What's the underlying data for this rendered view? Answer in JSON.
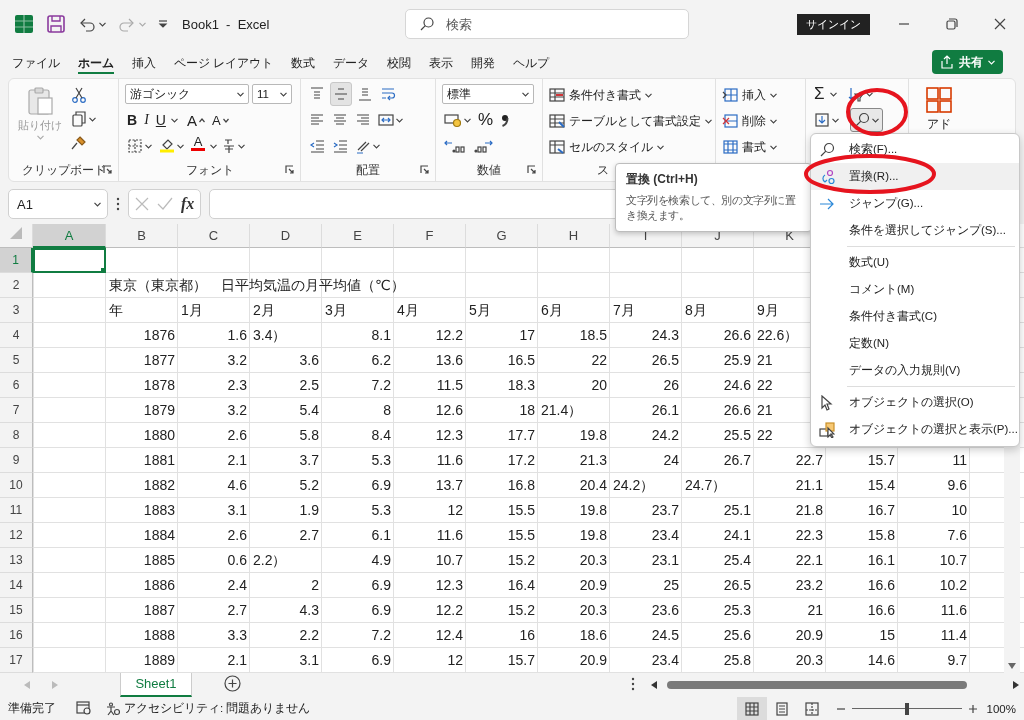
{
  "title_bar": {
    "title": "Book1  -  Excel",
    "search": {
      "placeholder": "検索"
    },
    "sign_in": "サインイン"
  },
  "menu_tabs": [
    {
      "label": "ファイル",
      "selected": false
    },
    {
      "label": "ホーム",
      "selected": true
    },
    {
      "label": "挿入",
      "selected": false
    },
    {
      "label": "ページ レイアウト",
      "selected": false
    },
    {
      "label": "数式",
      "selected": false
    },
    {
      "label": "データ",
      "selected": false
    },
    {
      "label": "校閲",
      "selected": false
    },
    {
      "label": "表示",
      "selected": false
    },
    {
      "label": "開発",
      "selected": false
    },
    {
      "label": "ヘルプ",
      "selected": false
    }
  ],
  "share_button": {
    "label": "共有"
  },
  "ribbon": {
    "clipboard": {
      "label": "クリップボード",
      "paste": {
        "label": "貼り付け",
        "disabled": true
      }
    },
    "font": {
      "label": "フォント",
      "font_name": "游ゴシック",
      "font_size": "11",
      "bold": "B",
      "italic": "I",
      "underline": "U",
      "grow": "A",
      "shrink": "A",
      "font_color_label": "A"
    },
    "alignment": {
      "label": "配置",
      "vertical": [
        {
          "kind": "top",
          "selected": false
        },
        {
          "kind": "middle",
          "selected": true
        },
        {
          "kind": "bottom",
          "selected": false
        }
      ]
    },
    "number": {
      "label": "数値",
      "format": "標準",
      "percent": "%"
    },
    "styles": {
      "label": "ス",
      "commands": [
        {
          "kind": "conditional",
          "label": "条件付き書式"
        },
        {
          "kind": "table",
          "label": "テーブルとして書式設定"
        },
        {
          "kind": "cellstyle",
          "label": "セルのスタイル"
        }
      ]
    },
    "cells": {
      "commands": [
        {
          "kind": "insert",
          "label": "挿入"
        },
        {
          "kind": "delete",
          "label": "削除"
        },
        {
          "kind": "format",
          "label": "書式"
        }
      ]
    },
    "editing": {
      "sum": "Σ",
      "find_pressed": true
    },
    "add_in": {
      "label": "アド"
    }
  },
  "formula_bar": {
    "name_box": "A1",
    "fx": "fx"
  },
  "sheet": {
    "columns": [
      {
        "label": "A",
        "selected": true
      },
      {
        "label": "B",
        "selected": false
      },
      {
        "label": "C",
        "selected": false
      },
      {
        "label": "D",
        "selected": false
      },
      {
        "label": "E",
        "selected": false
      },
      {
        "label": "F",
        "selected": false
      },
      {
        "label": "G",
        "selected": false
      },
      {
        "label": "H",
        "selected": false
      },
      {
        "label": "I",
        "selected": false
      },
      {
        "label": "J",
        "selected": false
      },
      {
        "label": "K",
        "selected": false
      }
    ],
    "rows": [
      {
        "label": "1",
        "selected": true,
        "cells": []
      },
      {
        "label": "2",
        "selected": false,
        "cells": [
          null,
          {
            "text": "東京（東京都）　日平均気温の月平均値（℃）",
            "kind": "text"
          }
        ]
      },
      {
        "label": "3",
        "selected": false,
        "cells": [
          null,
          {
            "text": "年",
            "kind": "text"
          },
          {
            "text": "1月",
            "kind": "text"
          },
          {
            "text": "2月",
            "kind": "text"
          },
          {
            "text": "3月",
            "kind": "text"
          },
          {
            "text": "4月",
            "kind": "text"
          },
          {
            "text": "5月",
            "kind": "text"
          },
          {
            "text": "6月",
            "kind": "text"
          },
          {
            "text": "7月",
            "kind": "text"
          },
          {
            "text": "8月",
            "kind": "text"
          },
          {
            "text": "9月",
            "kind": "text"
          }
        ]
      },
      {
        "label": "4",
        "selected": false,
        "cells": [
          null,
          "1876",
          "1.6",
          {
            "text": "3.4）",
            "kind": "text"
          },
          "8.1",
          "12.2",
          "17",
          "18.5",
          "24.3",
          "26.6",
          {
            "text": "22.6）",
            "kind": "text"
          }
        ]
      },
      {
        "label": "5",
        "selected": false,
        "cells": [
          null,
          "1877",
          "3.2",
          "3.6",
          "6.2",
          "13.6",
          "16.5",
          "22",
          "26.5",
          "25.9",
          {
            "text": "21",
            "kind": "text"
          }
        ]
      },
      {
        "label": "6",
        "selected": false,
        "cells": [
          null,
          "1878",
          "2.3",
          "2.5",
          "7.2",
          "11.5",
          "18.3",
          "20",
          "26",
          "24.6",
          {
            "text": "22",
            "kind": "text"
          }
        ]
      },
      {
        "label": "7",
        "selected": false,
        "cells": [
          null,
          "1879",
          "3.2",
          "5.4",
          "8",
          "12.6",
          "18",
          {
            "text": "21.4）",
            "kind": "text"
          },
          "26.1",
          "26.6",
          {
            "text": "21",
            "kind": "text"
          }
        ]
      },
      {
        "label": "8",
        "selected": false,
        "cells": [
          null,
          "1880",
          "2.6",
          "5.8",
          "8.4",
          "12.3",
          "17.7",
          "19.8",
          "24.2",
          "25.5",
          {
            "text": "22",
            "kind": "text"
          }
        ]
      },
      {
        "label": "9",
        "selected": false,
        "cells": [
          null,
          "1881",
          "2.1",
          "3.7",
          "5.3",
          "11.6",
          "17.2",
          "21.3",
          "24",
          "26.7",
          "22.7",
          "15.7",
          "11"
        ]
      },
      {
        "label": "10",
        "selected": false,
        "cells": [
          null,
          "1882",
          "4.6",
          "5.2",
          "6.9",
          "13.7",
          "16.8",
          "20.4",
          {
            "text": "24.2）",
            "kind": "text"
          },
          {
            "text": "24.7）",
            "kind": "text"
          },
          "21.1",
          "15.4",
          "9.6"
        ]
      },
      {
        "label": "11",
        "selected": false,
        "cells": [
          null,
          "1883",
          "3.1",
          "1.9",
          "5.3",
          "12",
          "15.5",
          "19.8",
          "23.7",
          "25.1",
          "21.8",
          "16.7",
          "10"
        ]
      },
      {
        "label": "12",
        "selected": false,
        "cells": [
          null,
          "1884",
          "2.6",
          "2.7",
          "6.1",
          "11.6",
          "15.5",
          "19.8",
          "23.4",
          "24.1",
          "22.3",
          "15.8",
          "7.6"
        ]
      },
      {
        "label": "13",
        "selected": false,
        "cells": [
          null,
          "1885",
          "0.6",
          {
            "text": "2.2）",
            "kind": "text"
          },
          "4.9",
          "10.7",
          "15.2",
          "20.3",
          "23.1",
          "25.4",
          "22.1",
          "16.1",
          "10.7"
        ]
      },
      {
        "label": "14",
        "selected": false,
        "cells": [
          null,
          "1886",
          "2.4",
          "2",
          "6.9",
          "12.3",
          "16.4",
          "20.9",
          "25",
          "26.5",
          "23.2",
          "16.6",
          "10.2"
        ]
      },
      {
        "label": "15",
        "selected": false,
        "cells": [
          null,
          "1887",
          "2.7",
          "4.3",
          "6.9",
          "12.2",
          "15.2",
          "20.3",
          "23.6",
          "25.3",
          "21",
          "16.6",
          "11.6"
        ]
      },
      {
        "label": "16",
        "selected": false,
        "cells": [
          null,
          "1888",
          "3.3",
          "2.2",
          "7.2",
          "12.4",
          "16",
          "18.6",
          "24.5",
          "25.6",
          "20.9",
          "15",
          "11.4"
        ]
      },
      {
        "label": "17",
        "selected": false,
        "cells": [
          null,
          "1889",
          "2.1",
          "3.1",
          "6.9",
          "12",
          "15.7",
          "20.9",
          "23.4",
          "25.8",
          "20.3",
          "14.6",
          "9.7"
        ]
      }
    ]
  },
  "sheet_tabs": [
    {
      "label": "Sheet1",
      "selected": true
    }
  ],
  "status_bar": {
    "mode": "準備完了",
    "accessibility": "アクセシビリティ: 問題ありません",
    "views": [
      {
        "kind": "normal",
        "selected": true
      },
      {
        "kind": "page-layout",
        "selected": false
      },
      {
        "kind": "page-break",
        "selected": false
      }
    ],
    "zoom": {
      "level": 0.5,
      "reading": "100%"
    }
  },
  "tooltip": {
    "title": "置換 (Ctrl+H)",
    "text": "文字列を検索して、別の文字列に置き換えます。"
  },
  "find_menu": {
    "items": [
      {
        "kind": "find",
        "label": "検索(F)...",
        "selected": false
      },
      {
        "kind": "replace",
        "label": "置換(R)...",
        "selected": true
      },
      {
        "kind": "goto",
        "label": "ジャンプ(G)...",
        "selected": false
      },
      {
        "kind": "plain",
        "label": "条件を選択してジャンプ(S)...",
        "selected": false
      },
      {
        "kind": "separator"
      },
      {
        "kind": "plain",
        "label": "数式(U)",
        "selected": false
      },
      {
        "kind": "plain",
        "label": "コメント(M)",
        "selected": false
      },
      {
        "kind": "plain",
        "label": "条件付き書式(C)",
        "selected": false
      },
      {
        "kind": "plain",
        "label": "定数(N)",
        "selected": false
      },
      {
        "kind": "plain",
        "label": "データの入力規則(V)",
        "selected": false
      },
      {
        "kind": "separator"
      },
      {
        "kind": "pointer",
        "label": "オブジェクトの選択(O)",
        "selected": false
      },
      {
        "kind": "pane",
        "label": "オブジェクトの選択と表示(P)...",
        "selected": false
      }
    ]
  },
  "annotations": [
    {
      "kind": "ellipse"
    },
    {
      "kind": "ellipse"
    }
  ]
}
